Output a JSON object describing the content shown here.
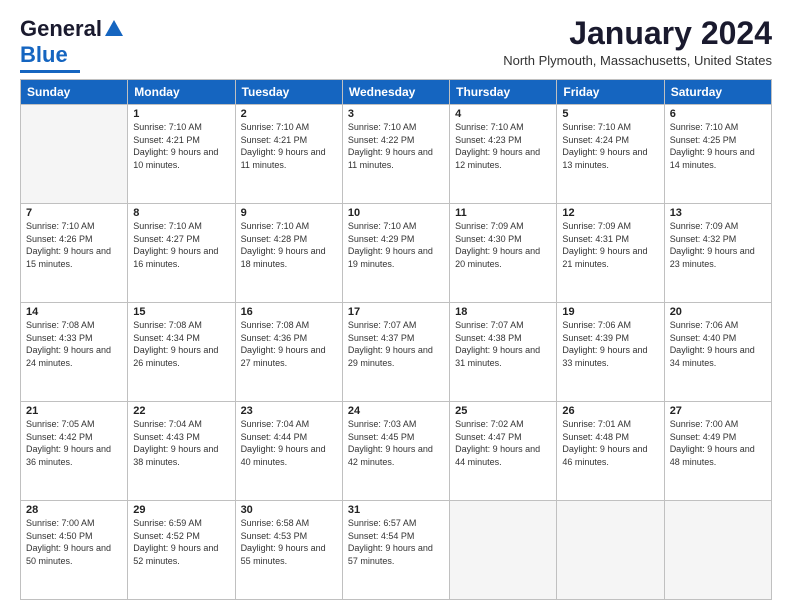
{
  "header": {
    "logo_general": "General",
    "logo_blue": "Blue",
    "month_title": "January 2024",
    "location": "North Plymouth, Massachusetts, United States"
  },
  "weekdays": [
    "Sunday",
    "Monday",
    "Tuesday",
    "Wednesday",
    "Thursday",
    "Friday",
    "Saturday"
  ],
  "weeks": [
    [
      {
        "day": "",
        "sunrise": "",
        "sunset": "",
        "daylight": ""
      },
      {
        "day": "1",
        "sunrise": "Sunrise: 7:10 AM",
        "sunset": "Sunset: 4:21 PM",
        "daylight": "Daylight: 9 hours and 10 minutes."
      },
      {
        "day": "2",
        "sunrise": "Sunrise: 7:10 AM",
        "sunset": "Sunset: 4:21 PM",
        "daylight": "Daylight: 9 hours and 11 minutes."
      },
      {
        "day": "3",
        "sunrise": "Sunrise: 7:10 AM",
        "sunset": "Sunset: 4:22 PM",
        "daylight": "Daylight: 9 hours and 11 minutes."
      },
      {
        "day": "4",
        "sunrise": "Sunrise: 7:10 AM",
        "sunset": "Sunset: 4:23 PM",
        "daylight": "Daylight: 9 hours and 12 minutes."
      },
      {
        "day": "5",
        "sunrise": "Sunrise: 7:10 AM",
        "sunset": "Sunset: 4:24 PM",
        "daylight": "Daylight: 9 hours and 13 minutes."
      },
      {
        "day": "6",
        "sunrise": "Sunrise: 7:10 AM",
        "sunset": "Sunset: 4:25 PM",
        "daylight": "Daylight: 9 hours and 14 minutes."
      }
    ],
    [
      {
        "day": "7",
        "sunrise": "Sunrise: 7:10 AM",
        "sunset": "Sunset: 4:26 PM",
        "daylight": "Daylight: 9 hours and 15 minutes."
      },
      {
        "day": "8",
        "sunrise": "Sunrise: 7:10 AM",
        "sunset": "Sunset: 4:27 PM",
        "daylight": "Daylight: 9 hours and 16 minutes."
      },
      {
        "day": "9",
        "sunrise": "Sunrise: 7:10 AM",
        "sunset": "Sunset: 4:28 PM",
        "daylight": "Daylight: 9 hours and 18 minutes."
      },
      {
        "day": "10",
        "sunrise": "Sunrise: 7:10 AM",
        "sunset": "Sunset: 4:29 PM",
        "daylight": "Daylight: 9 hours and 19 minutes."
      },
      {
        "day": "11",
        "sunrise": "Sunrise: 7:09 AM",
        "sunset": "Sunset: 4:30 PM",
        "daylight": "Daylight: 9 hours and 20 minutes."
      },
      {
        "day": "12",
        "sunrise": "Sunrise: 7:09 AM",
        "sunset": "Sunset: 4:31 PM",
        "daylight": "Daylight: 9 hours and 21 minutes."
      },
      {
        "day": "13",
        "sunrise": "Sunrise: 7:09 AM",
        "sunset": "Sunset: 4:32 PM",
        "daylight": "Daylight: 9 hours and 23 minutes."
      }
    ],
    [
      {
        "day": "14",
        "sunrise": "Sunrise: 7:08 AM",
        "sunset": "Sunset: 4:33 PM",
        "daylight": "Daylight: 9 hours and 24 minutes."
      },
      {
        "day": "15",
        "sunrise": "Sunrise: 7:08 AM",
        "sunset": "Sunset: 4:34 PM",
        "daylight": "Daylight: 9 hours and 26 minutes."
      },
      {
        "day": "16",
        "sunrise": "Sunrise: 7:08 AM",
        "sunset": "Sunset: 4:36 PM",
        "daylight": "Daylight: 9 hours and 27 minutes."
      },
      {
        "day": "17",
        "sunrise": "Sunrise: 7:07 AM",
        "sunset": "Sunset: 4:37 PM",
        "daylight": "Daylight: 9 hours and 29 minutes."
      },
      {
        "day": "18",
        "sunrise": "Sunrise: 7:07 AM",
        "sunset": "Sunset: 4:38 PM",
        "daylight": "Daylight: 9 hours and 31 minutes."
      },
      {
        "day": "19",
        "sunrise": "Sunrise: 7:06 AM",
        "sunset": "Sunset: 4:39 PM",
        "daylight": "Daylight: 9 hours and 33 minutes."
      },
      {
        "day": "20",
        "sunrise": "Sunrise: 7:06 AM",
        "sunset": "Sunset: 4:40 PM",
        "daylight": "Daylight: 9 hours and 34 minutes."
      }
    ],
    [
      {
        "day": "21",
        "sunrise": "Sunrise: 7:05 AM",
        "sunset": "Sunset: 4:42 PM",
        "daylight": "Daylight: 9 hours and 36 minutes."
      },
      {
        "day": "22",
        "sunrise": "Sunrise: 7:04 AM",
        "sunset": "Sunset: 4:43 PM",
        "daylight": "Daylight: 9 hours and 38 minutes."
      },
      {
        "day": "23",
        "sunrise": "Sunrise: 7:04 AM",
        "sunset": "Sunset: 4:44 PM",
        "daylight": "Daylight: 9 hours and 40 minutes."
      },
      {
        "day": "24",
        "sunrise": "Sunrise: 7:03 AM",
        "sunset": "Sunset: 4:45 PM",
        "daylight": "Daylight: 9 hours and 42 minutes."
      },
      {
        "day": "25",
        "sunrise": "Sunrise: 7:02 AM",
        "sunset": "Sunset: 4:47 PM",
        "daylight": "Daylight: 9 hours and 44 minutes."
      },
      {
        "day": "26",
        "sunrise": "Sunrise: 7:01 AM",
        "sunset": "Sunset: 4:48 PM",
        "daylight": "Daylight: 9 hours and 46 minutes."
      },
      {
        "day": "27",
        "sunrise": "Sunrise: 7:00 AM",
        "sunset": "Sunset: 4:49 PM",
        "daylight": "Daylight: 9 hours and 48 minutes."
      }
    ],
    [
      {
        "day": "28",
        "sunrise": "Sunrise: 7:00 AM",
        "sunset": "Sunset: 4:50 PM",
        "daylight": "Daylight: 9 hours and 50 minutes."
      },
      {
        "day": "29",
        "sunrise": "Sunrise: 6:59 AM",
        "sunset": "Sunset: 4:52 PM",
        "daylight": "Daylight: 9 hours and 52 minutes."
      },
      {
        "day": "30",
        "sunrise": "Sunrise: 6:58 AM",
        "sunset": "Sunset: 4:53 PM",
        "daylight": "Daylight: 9 hours and 55 minutes."
      },
      {
        "day": "31",
        "sunrise": "Sunrise: 6:57 AM",
        "sunset": "Sunset: 4:54 PM",
        "daylight": "Daylight: 9 hours and 57 minutes."
      },
      {
        "day": "",
        "sunrise": "",
        "sunset": "",
        "daylight": ""
      },
      {
        "day": "",
        "sunrise": "",
        "sunset": "",
        "daylight": ""
      },
      {
        "day": "",
        "sunrise": "",
        "sunset": "",
        "daylight": ""
      }
    ]
  ]
}
